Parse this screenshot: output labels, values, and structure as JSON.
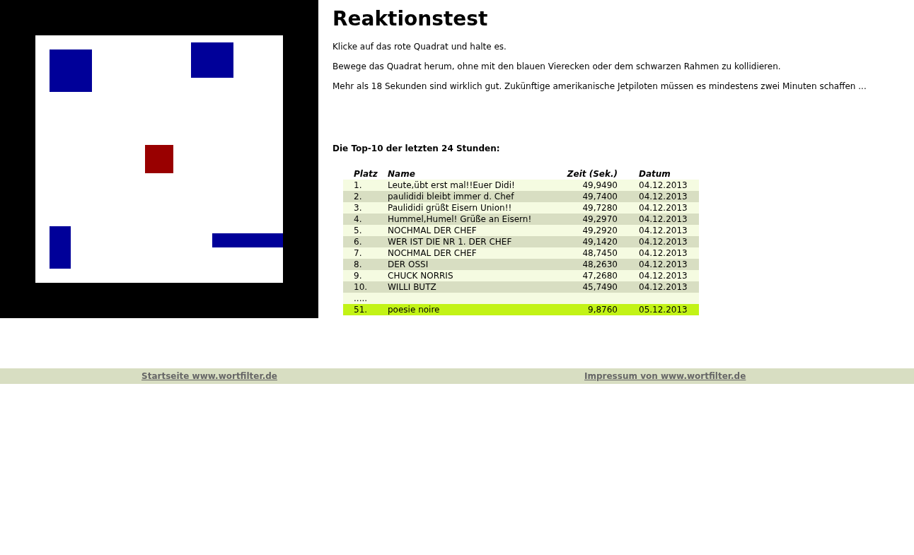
{
  "title": "Reaktionstest",
  "paragraphs": [
    "Klicke auf das rote Quadrat und halte es.",
    "Bewege das Quadrat herum, ohne mit den blauen Vierecken oder dem schwarzen Rahmen zu kollidieren.",
    "Mehr als 18 Sekunden sind wirklich gut. Zukünftige amerikanische Jetpiloten müssen es mindestens zwei Minuten schaffen ..."
  ],
  "highscores": {
    "heading": "Die Top-10 der letzten 24 Stunden:",
    "columns": [
      "Platz",
      "Name",
      "Zeit (Sek.)",
      "Datum"
    ],
    "rows": [
      {
        "kind": "entry",
        "rank": "1.",
        "name": "Leute,übt erst mal!!Euer Didi!",
        "time": "49,9490",
        "date": "04.12.2013",
        "highlighted": false
      },
      {
        "kind": "entry",
        "rank": "2.",
        "name": "paulididi bleibt immer d. Chef",
        "time": "49,7400",
        "date": "04.12.2013",
        "highlighted": false
      },
      {
        "kind": "entry",
        "rank": "3.",
        "name": "Paulididi grüßt Eisern Union!!",
        "time": "49,7280",
        "date": "04.12.2013",
        "highlighted": false
      },
      {
        "kind": "entry",
        "rank": "4.",
        "name": "Hummel,Humel! Grüße an Eisern!",
        "time": "49,2970",
        "date": "04.12.2013",
        "highlighted": false
      },
      {
        "kind": "entry",
        "rank": "5.",
        "name": "NOCHMAL DER CHEF",
        "time": "49,2920",
        "date": "04.12.2013",
        "highlighted": false
      },
      {
        "kind": "entry",
        "rank": "6.",
        "name": "WER IST DIE NR 1. DER CHEF",
        "time": "49,1420",
        "date": "04.12.2013",
        "highlighted": false
      },
      {
        "kind": "entry",
        "rank": "7.",
        "name": "NOCHMAL DER CHEF",
        "time": "48,7450",
        "date": "04.12.2013",
        "highlighted": false
      },
      {
        "kind": "entry",
        "rank": "8.",
        "name": "DER OSSI",
        "time": "48,2630",
        "date": "04.12.2013",
        "highlighted": false
      },
      {
        "kind": "entry",
        "rank": "9.",
        "name": "CHUCK NORRIS",
        "time": "47,2680",
        "date": "04.12.2013",
        "highlighted": false
      },
      {
        "kind": "entry",
        "rank": "10.",
        "name": "WILLI BUTZ",
        "time": "45,7490",
        "date": "04.12.2013",
        "highlighted": false
      },
      {
        "kind": "gap",
        "rank": "....."
      },
      {
        "kind": "entry",
        "rank": "51.",
        "name": "poesie noire",
        "time": "9,8760",
        "date": "05.12.2013",
        "highlighted": true
      }
    ]
  },
  "footer_links": [
    "Startseite www.wortfilter.de",
    "Impressum von www.wortfilter.de"
  ]
}
